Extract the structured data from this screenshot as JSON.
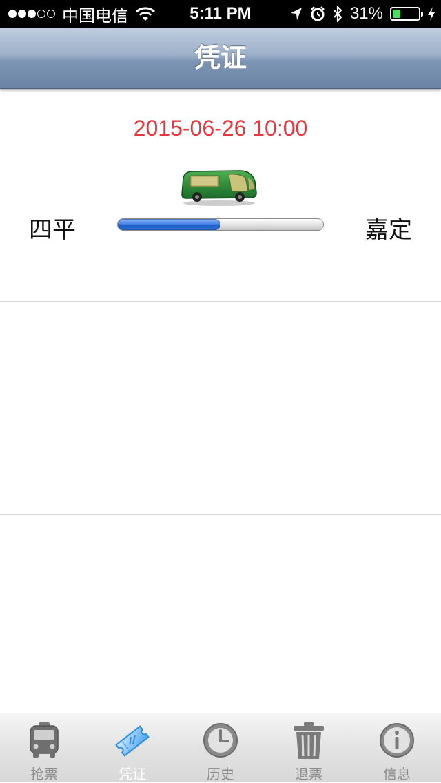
{
  "status_bar": {
    "carrier": "中国电信",
    "time": "5:11 PM",
    "battery_percent": "31%",
    "battery_level": 0.31,
    "signal_bars_filled": 3,
    "signal_bars_total": 5
  },
  "nav": {
    "title": "凭证"
  },
  "ticket": {
    "departure_time": "2015-06-26 10:00",
    "from_station": "四平",
    "to_station": "嘉定",
    "progress": 0.5,
    "icon": "bus-icon"
  },
  "tabs": [
    {
      "label": "抢票",
      "icon": "bus-icon",
      "active": false
    },
    {
      "label": "凭证",
      "icon": "ticket-icon",
      "active": true
    },
    {
      "label": "历史",
      "icon": "clock-icon",
      "active": false
    },
    {
      "label": "退票",
      "icon": "trash-icon",
      "active": false
    },
    {
      "label": "信息",
      "icon": "info-icon",
      "active": false
    }
  ],
  "colors": {
    "departure_time": "#e8363e",
    "progress_fill": "#4a86e8",
    "battery": "#4cd964"
  }
}
